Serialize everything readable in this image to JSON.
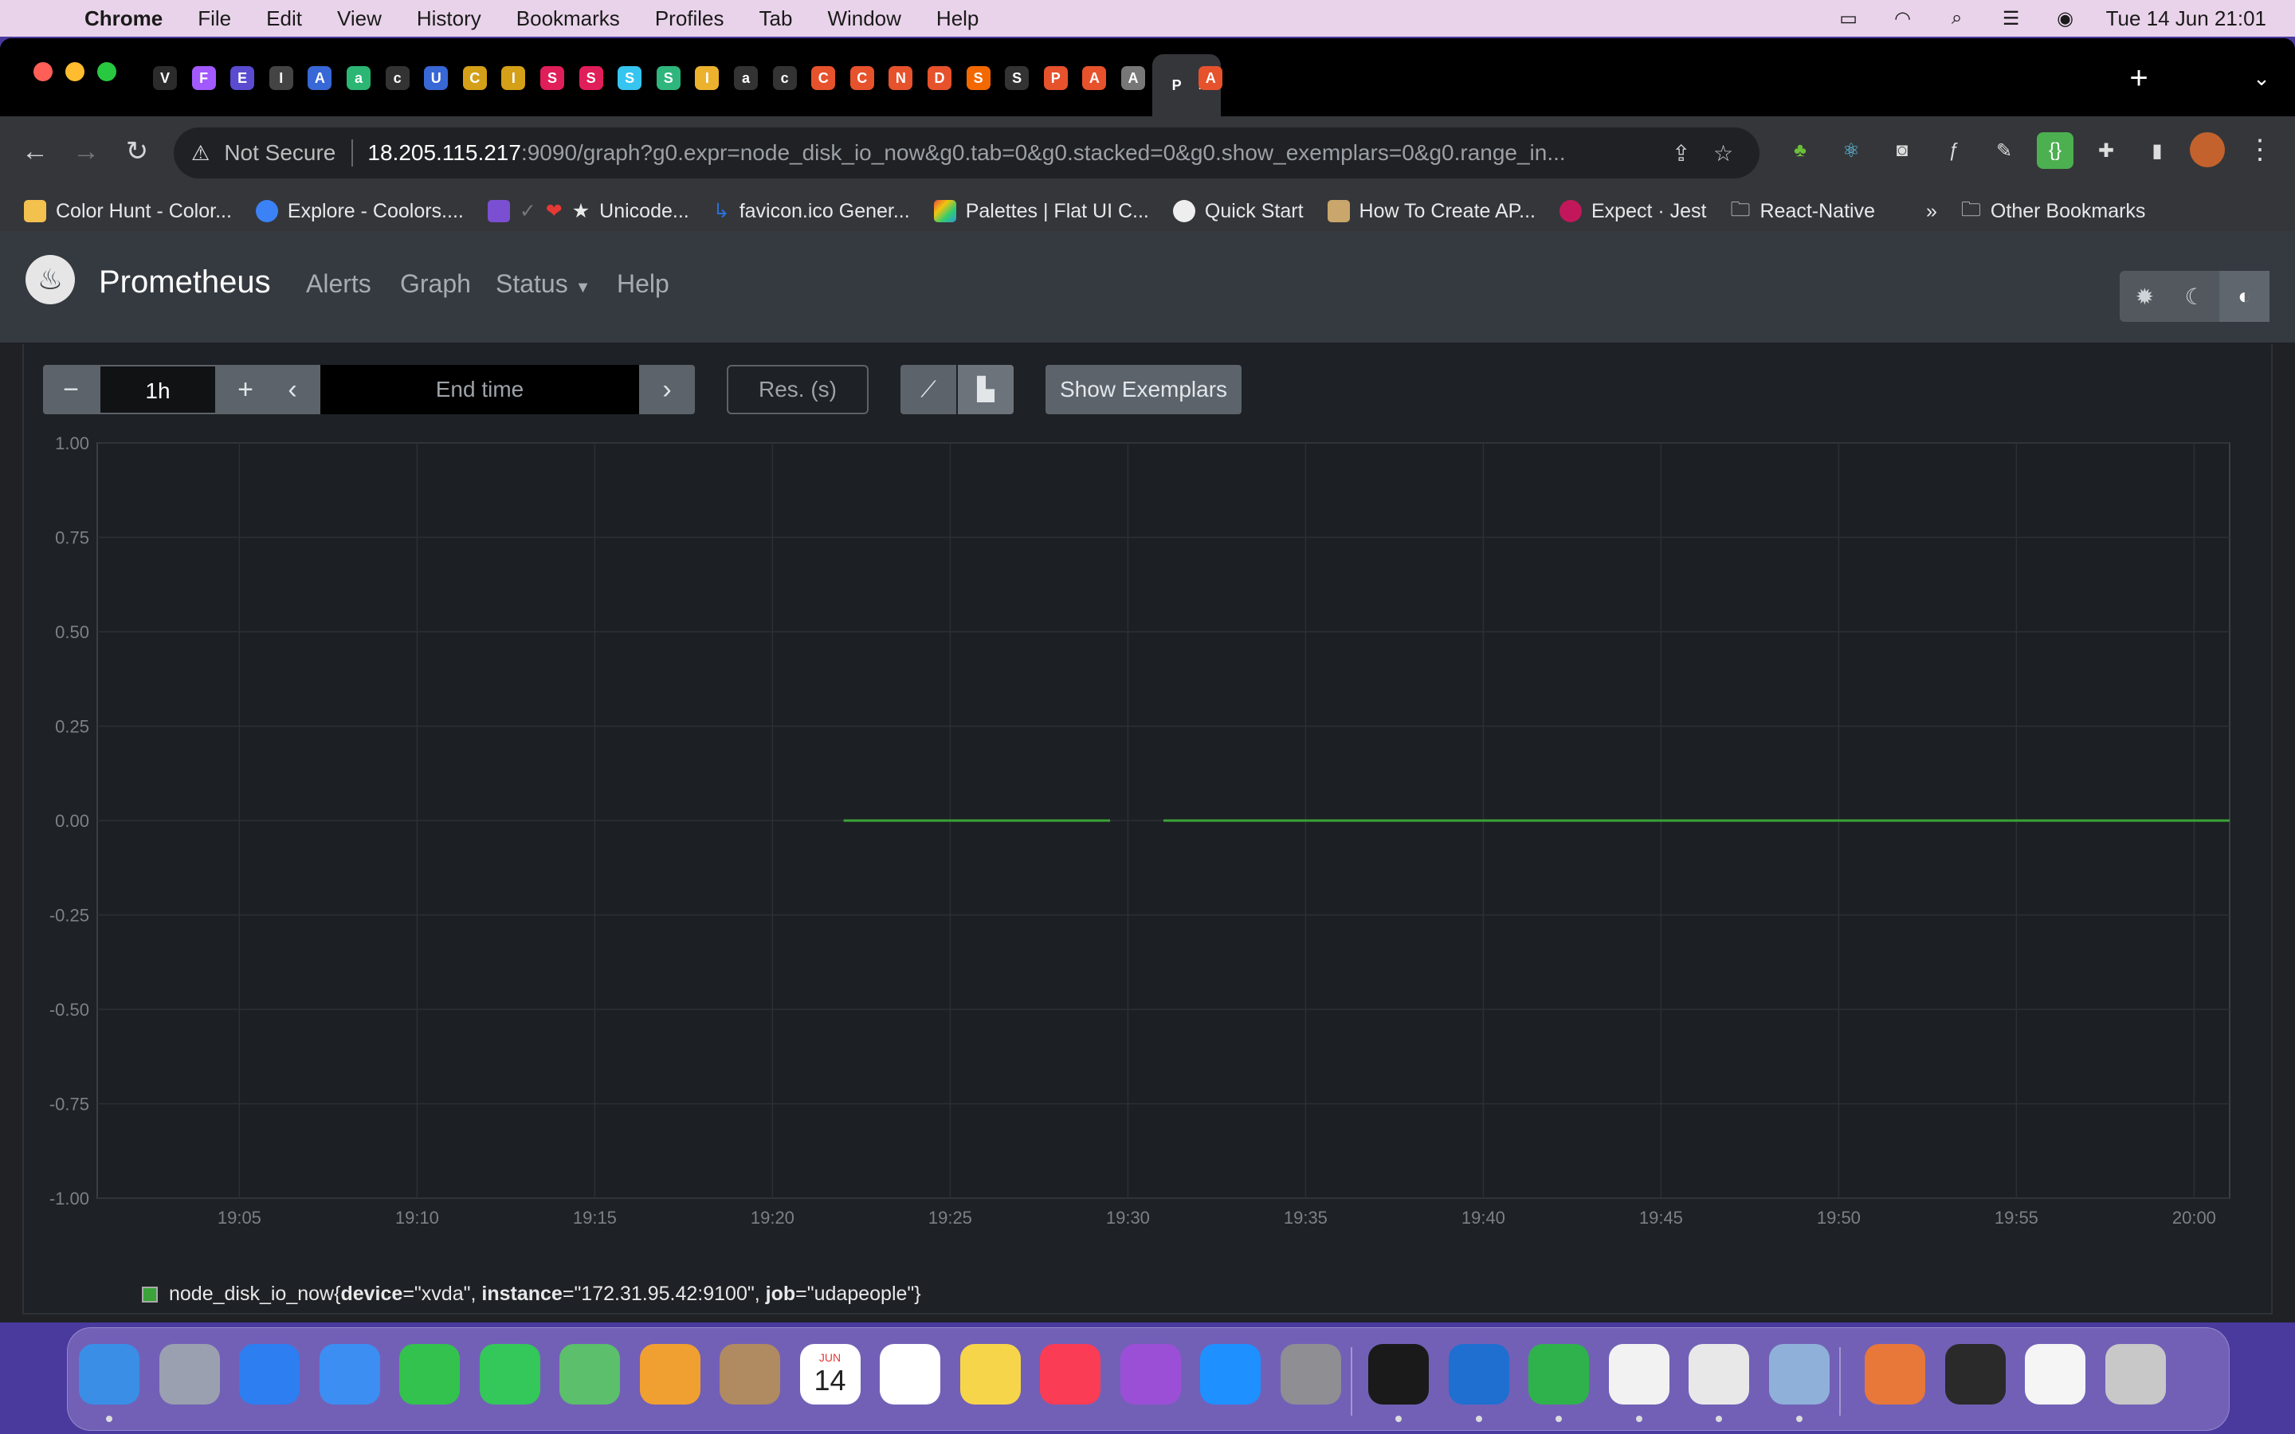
{
  "menubar": {
    "app": "Chrome",
    "items": [
      "File",
      "Edit",
      "View",
      "History",
      "Bookmarks",
      "Profiles",
      "Tab",
      "Window",
      "Help"
    ],
    "datetime": "Tue 14 Jun  21:01"
  },
  "tabs": [
    {
      "letter": "V",
      "color": "#2b2b2b"
    },
    {
      "letter": "F",
      "color": "#a259ff"
    },
    {
      "letter": "E",
      "color": "#5a4bd1"
    },
    {
      "letter": "I",
      "color": "#444"
    },
    {
      "letter": "A",
      "color": "#3867d6"
    },
    {
      "letter": "a",
      "color": "#2bb673"
    },
    {
      "letter": "c",
      "color": "#333"
    },
    {
      "letter": "U",
      "color": "#3867d6"
    },
    {
      "letter": "C",
      "color": "#d4a017"
    },
    {
      "letter": "I",
      "color": "#d4a017"
    },
    {
      "letter": "S",
      "color": "#e01e5a"
    },
    {
      "letter": "S",
      "color": "#e01e5a"
    },
    {
      "letter": "S",
      "color": "#36c5f0"
    },
    {
      "letter": "S",
      "color": "#2eb67d"
    },
    {
      "letter": "I",
      "color": "#ecb22e"
    },
    {
      "letter": "a",
      "color": "#333"
    },
    {
      "letter": "c",
      "color": "#333"
    },
    {
      "letter": "C",
      "color": "#e6522c"
    },
    {
      "letter": "C",
      "color": "#e6522c"
    },
    {
      "letter": "N",
      "color": "#e6522c"
    },
    {
      "letter": "D",
      "color": "#e6522c"
    },
    {
      "letter": "S",
      "color": "#f46800"
    },
    {
      "letter": "S",
      "color": "#333"
    },
    {
      "letter": "P",
      "color": "#e6522c"
    },
    {
      "letter": "A",
      "color": "#e6522c"
    },
    {
      "letter": "A",
      "color": "#777"
    },
    {
      "letter": "P",
      "color": "#35363a",
      "active": true
    },
    {
      "letter": "A",
      "color": "#e6522c"
    }
  ],
  "omnibox": {
    "security": "Not Secure",
    "host": "18.205.115.217",
    "path": ":9090/graph?g0.expr=node_disk_io_now&g0.tab=0&g0.stacked=0&g0.show_exemplars=0&g0.range_in..."
  },
  "bookmarks": [
    {
      "label": "Color Hunt - Color...",
      "color": "#f2c14e"
    },
    {
      "label": "Explore - Coolors....",
      "color": "#3b82f6"
    },
    {
      "label": "Unicode...",
      "color": "#7b4fd1"
    },
    {
      "label": "favicon.ico Gener...",
      "color": "#2a6fdb"
    },
    {
      "label": "Palettes | Flat UI C...",
      "color": "#e67e22"
    },
    {
      "label": "Quick Start",
      "color": "#eeeeee"
    },
    {
      "label": "How To Create AP...",
      "color": "#c9a66b"
    },
    {
      "label": "Expect · Jest",
      "color": "#c2185b"
    },
    {
      "label": "React-Native",
      "color": "#cccccc"
    }
  ],
  "bookmarks_more": "»",
  "bookmarks_other": "Other Bookmarks",
  "prometheus": {
    "brand": "Prometheus",
    "nav": [
      "Alerts",
      "Graph",
      "Status",
      "Help"
    ],
    "range": "1h",
    "endtime_placeholder": "End time",
    "res_placeholder": "Res. (s)",
    "exemplars_label": "Show Exemplars"
  },
  "chart_data": {
    "type": "line",
    "title": "",
    "xlabel": "",
    "ylabel": "",
    "ylim": [
      -1.0,
      1.0
    ],
    "yticks": [
      "1.00",
      "0.75",
      "0.50",
      "0.25",
      "0.00",
      "-0.25",
      "-0.50",
      "-0.75",
      "-1.00"
    ],
    "xlim": [
      "19:01",
      "20:01"
    ],
    "xticks": [
      "19:05",
      "19:10",
      "19:15",
      "19:20",
      "19:25",
      "19:30",
      "19:35",
      "19:40",
      "19:45",
      "19:50",
      "19:55",
      "20:00"
    ],
    "grid": true,
    "legend_placement": "bottom-left",
    "series": [
      {
        "legend": {
          "metric": "node_disk_io_now",
          "labels": [
            {
              "key": "device",
              "value": "\"xvda\""
            },
            {
              "key": "instance",
              "value": "\"172.31.95.42:9100\""
            },
            {
              "key": "job",
              "value": "\"udapeople\""
            }
          ]
        },
        "color": "#3aa33a",
        "segments": [
          {
            "x": [
              "19:22",
              "19:29.5"
            ],
            "y": [
              0,
              0
            ]
          },
          {
            "x": [
              "19:31",
              "20:01"
            ],
            "y": [
              0,
              0
            ]
          }
        ]
      }
    ]
  },
  "dock": [
    {
      "name": "finder",
      "color": "#3a8ee6",
      "dot": true
    },
    {
      "name": "launchpad",
      "color": "#9aa0b0"
    },
    {
      "name": "safari",
      "color": "#2d7ef0"
    },
    {
      "name": "mail",
      "color": "#3c8ef3"
    },
    {
      "name": "facetime",
      "color": "#33c24d"
    },
    {
      "name": "messages",
      "color": "#34c759"
    },
    {
      "name": "maps",
      "color": "#5bbf6b"
    },
    {
      "name": "photos",
      "color": "#f0a030"
    },
    {
      "name": "contacts",
      "color": "#b08a60"
    },
    {
      "name": "calendar",
      "color": "#ffffff",
      "text": "14",
      "month": "JUN"
    },
    {
      "name": "reminders",
      "color": "#ffffff"
    },
    {
      "name": "notes",
      "color": "#f7d54a"
    },
    {
      "name": "music",
      "color": "#fa3c55"
    },
    {
      "name": "podcasts",
      "color": "#9b4fd6"
    },
    {
      "name": "app-store",
      "color": "#1e90ff"
    },
    {
      "name": "system-preferences",
      "color": "#8e8e93"
    },
    {
      "name": "terminal",
      "color": "#1a1a1a",
      "dot": true
    },
    {
      "name": "vscode",
      "color": "#1f6fd1",
      "dot": true
    },
    {
      "name": "numbers",
      "color": "#2fb24c",
      "dot": true
    },
    {
      "name": "textedit",
      "color": "#f2f2f2",
      "dot": true
    },
    {
      "name": "chrome",
      "color": "#e8e8e8",
      "dot": true
    },
    {
      "name": "preview",
      "color": "#8fb0d8",
      "dot": true
    },
    {
      "name": "downloads-stack",
      "color": "#e8773a"
    },
    {
      "name": "window-1",
      "color": "#2a2a2a"
    },
    {
      "name": "window-2",
      "color": "#f5f5f5"
    },
    {
      "name": "trash",
      "color": "#c8c8c8"
    }
  ]
}
